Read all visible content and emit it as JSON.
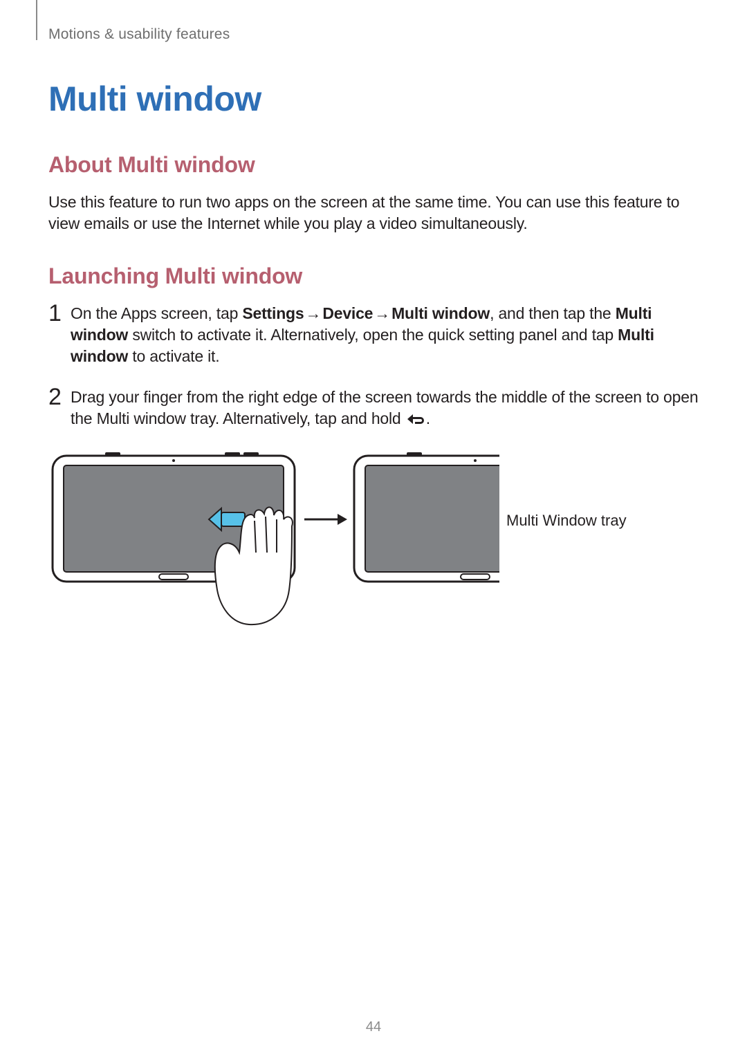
{
  "breadcrumb": "Motions & usability features",
  "title": "Multi window",
  "headings": {
    "about": "About Multi window",
    "launching": "Launching Multi window"
  },
  "about_text": "Use this feature to run two apps on the screen at the same time. You can use this feature to view emails or use the Internet while you play a video simultaneously.",
  "steps": [
    {
      "num": "1",
      "prefix": "On the Apps screen, tap ",
      "path": [
        "Settings",
        "Device",
        "Multi window"
      ],
      "mid": ", and then tap the ",
      "bold_mid": "Multi window",
      "mid2": " switch to activate it. Alternatively, open the quick setting panel and tap ",
      "bold_tail": "Multi window",
      "tail": " to activate it."
    },
    {
      "num": "2",
      "text_before_icon": "Drag your finger from the right edge of the screen towards the middle of the screen to open the Multi window tray. Alternatively, tap and hold ",
      "text_after_icon": "."
    }
  ],
  "callout": "Multi Window tray",
  "page_number": "44",
  "arrow_glyph": "→"
}
